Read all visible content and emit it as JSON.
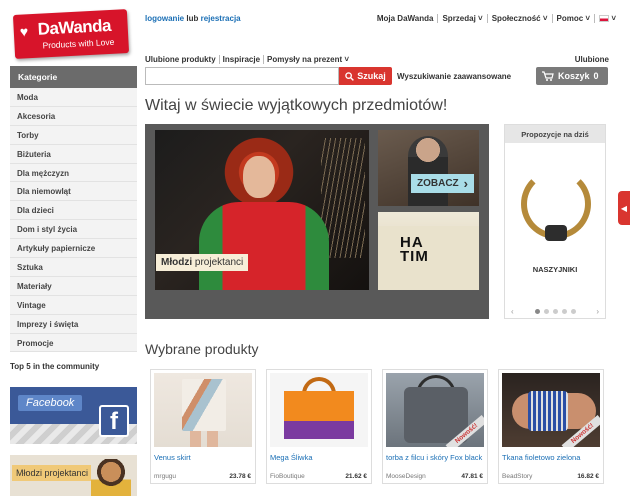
{
  "header": {
    "logo_name": "DaWanda",
    "logo_tagline": "Products with Love",
    "login": "logowanie",
    "login_sep": "lub",
    "register": "rejestracja",
    "top_nav": [
      "Moja DaWanda",
      "Sprzedaj ˅",
      "Społeczność ˅",
      "Pomoc ˅"
    ],
    "sub_nav": [
      "Ulubione produkty",
      "Inspiracje",
      "Pomysły na prezent ˅"
    ],
    "favorites": "Ulubione"
  },
  "search": {
    "placeholder": "",
    "button": "Szukaj",
    "advanced": "Wyszukiwanie zaawansowane"
  },
  "cart": {
    "label": "Koszyk",
    "count": "0"
  },
  "sidebar": {
    "heading": "Kategorie",
    "items": [
      "Moda",
      "Akcesoria",
      "Torby",
      "Biżuteria",
      "Dla mężczyzn",
      "Dla niemowląt",
      "Dla dzieci",
      "Dom i styl życia",
      "Artykuły papiernicze",
      "Sztuka",
      "Materiały",
      "Vintage",
      "Imprezy i święta",
      "Promocje"
    ],
    "top5": "Top 5 in the community",
    "facebook_label": "Facebook",
    "facebook_logo": "f",
    "young_designers_label": "Młodzi projektanci"
  },
  "main": {
    "welcome": "Witaj w świecie wyjątkowych przedmiotów!",
    "hero_label_bold": "Młodzi",
    "hero_label_rest": " projektanci",
    "zobacz": "ZOBACZ",
    "shirt_text": "HA\nTIM",
    "proposals_heading": "Propozycje na dziś",
    "proposals_item": "NASZYJNIKI",
    "proposals_prev": "‹",
    "proposals_next": "›",
    "featured_heading": "Wybrane produkty"
  },
  "products": [
    {
      "title": "Venus skirt",
      "shop": "mrgugu",
      "price": "23.78 €",
      "badge": ""
    },
    {
      "title": "Mega Śliwka",
      "shop": "FioBoutique",
      "price": "21.62 €",
      "badge": ""
    },
    {
      "title": "torba z filcu i skóry Fox black",
      "shop": "MooseDesign",
      "price": "47.81 €",
      "badge": "Nowość!"
    },
    {
      "title": "Tkana fioletowo zielona",
      "shop": "BeadStory",
      "price": "16.82 €",
      "badge": "Nowość!"
    }
  ],
  "colors": {
    "brand_red": "#d7142a",
    "link_blue": "#1b6fb5",
    "search_red": "#d9352f",
    "sidebar_head": "#6b6b6b"
  },
  "icons": {
    "search": "search-icon",
    "cart": "cart-icon",
    "heart": "heart-icon",
    "flag": "flag-icon"
  }
}
